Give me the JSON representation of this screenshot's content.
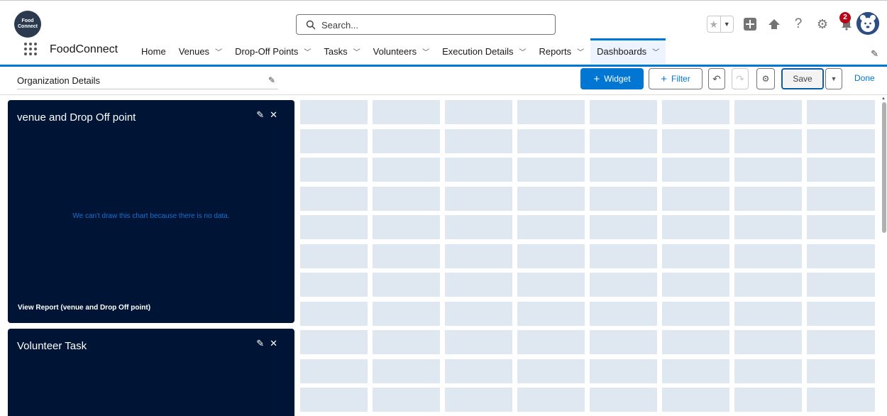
{
  "header": {
    "logo_text": "Food Connect",
    "search_placeholder": "Search...",
    "notification_count": "2",
    "icons": [
      "star-icon",
      "chevron-down-icon",
      "add-icon",
      "trailhead-icon",
      "help-icon",
      "settings-icon",
      "bell-icon",
      "avatar"
    ]
  },
  "nav": {
    "app_name": "FoodConnect",
    "items": [
      {
        "label": "Home",
        "dropdown": false
      },
      {
        "label": "Venues",
        "dropdown": true
      },
      {
        "label": "Drop-Off Points",
        "dropdown": true
      },
      {
        "label": "Tasks",
        "dropdown": true
      },
      {
        "label": "Volunteers",
        "dropdown": true
      },
      {
        "label": "Execution Details",
        "dropdown": true
      },
      {
        "label": "Reports",
        "dropdown": true
      },
      {
        "label": "Dashboards",
        "dropdown": true,
        "active": true
      }
    ]
  },
  "toolbar": {
    "dashboard_name": "Organization Details",
    "widget_label": "Widget",
    "filter_label": "Filter",
    "save_label": "Save",
    "done_label": "Done"
  },
  "widgets": [
    {
      "title": "venue and Drop Off point",
      "empty_message": "We can't draw this chart because there is no data.",
      "report_link": "View Report (venue and Drop Off point)"
    },
    {
      "title": "Volunteer Task"
    }
  ],
  "colors": {
    "accent": "#0176d3",
    "widget_bg": "#001535",
    "grid_cell": "#dfe7f1",
    "badge": "#ba0517"
  }
}
